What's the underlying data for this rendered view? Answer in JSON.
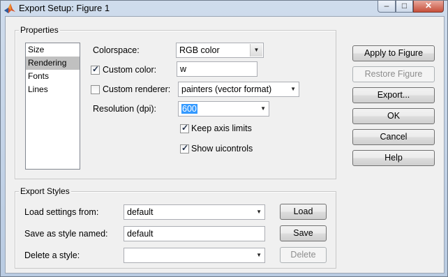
{
  "window": {
    "title": "Export Setup: Figure 1"
  },
  "properties": {
    "group_label": "Properties",
    "categories": [
      "Size",
      "Rendering",
      "Fonts",
      "Lines"
    ],
    "selected_category": "Rendering",
    "colorspace": {
      "label": "Colorspace:",
      "value": "RGB color"
    },
    "custom_color": {
      "label": "Custom color:",
      "checked": true,
      "value": "w"
    },
    "custom_renderer": {
      "label": "Custom renderer:",
      "checked": false,
      "value": "painters (vector format)"
    },
    "resolution": {
      "label": "Resolution (dpi):",
      "value": "600"
    },
    "keep_axis_limits": {
      "label": "Keep axis limits",
      "checked": true
    },
    "show_uicontrols": {
      "label": "Show uicontrols",
      "checked": true
    }
  },
  "export_styles": {
    "group_label": "Export Styles",
    "load": {
      "label": "Load settings from:",
      "value": "default",
      "button": "Load"
    },
    "save": {
      "label": "Save as style named:",
      "value": "default",
      "button": "Save"
    },
    "delete": {
      "label": "Delete a style:",
      "value": "",
      "button": "Delete"
    }
  },
  "actions": {
    "apply": "Apply to Figure",
    "restore": "Restore Figure",
    "export": "Export...",
    "ok": "OK",
    "cancel": "Cancel",
    "help": "Help"
  },
  "icons": {
    "app": "matlab-icon",
    "minimize": "minimize-icon",
    "maximize": "maximize-icon",
    "close": "close-icon",
    "dropdown": "chevron-down-icon",
    "check": "checkmark-icon"
  },
  "colors": {
    "selection": "#3399ff",
    "list_selection": "#c0c0c0",
    "window_frame": "#b9cbe2"
  }
}
